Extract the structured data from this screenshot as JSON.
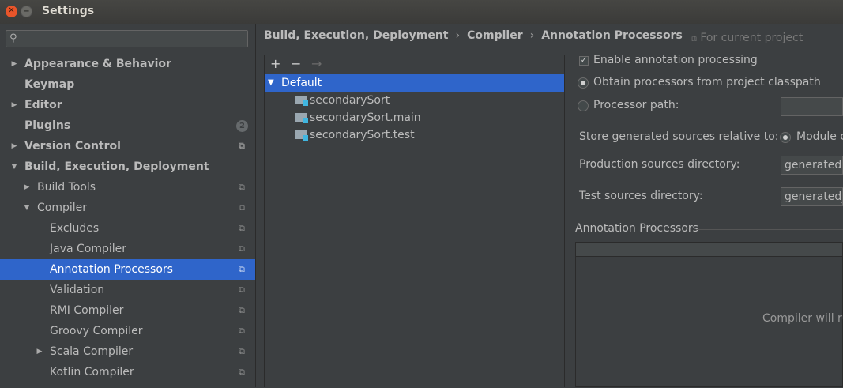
{
  "window": {
    "title": "Settings"
  },
  "search": {
    "placeholder": "",
    "value": ""
  },
  "tree": [
    {
      "label": "Appearance & Behavior",
      "arrow": "▶",
      "bold": true
    },
    {
      "label": "Keymap",
      "arrow": "",
      "bold": true
    },
    {
      "label": "Editor",
      "arrow": "▶",
      "bold": true
    },
    {
      "label": "Plugins",
      "arrow": "",
      "bold": true,
      "badge": "2"
    },
    {
      "label": "Version Control",
      "arrow": "▶",
      "bold": true,
      "project": true
    },
    {
      "label": "Build, Execution, Deployment",
      "arrow": "▼",
      "bold": true
    },
    {
      "label": "Build Tools",
      "arrow": "▶",
      "bold": false,
      "project": true
    },
    {
      "label": "Compiler",
      "arrow": "▼",
      "bold": false,
      "project": true
    },
    {
      "label": "Excludes",
      "arrow": "",
      "bold": false,
      "project": true
    },
    {
      "label": "Java Compiler",
      "arrow": "",
      "bold": false,
      "project": true
    },
    {
      "label": "Annotation Processors",
      "arrow": "",
      "bold": false,
      "project": true,
      "selected": true
    },
    {
      "label": "Validation",
      "arrow": "",
      "bold": false,
      "project": true
    },
    {
      "label": "RMI Compiler",
      "arrow": "",
      "bold": false,
      "project": true
    },
    {
      "label": "Groovy Compiler",
      "arrow": "",
      "bold": false,
      "project": true
    },
    {
      "label": "Scala Compiler",
      "arrow": "▶",
      "bold": false,
      "project": true
    },
    {
      "label": "Kotlin Compiler",
      "arrow": "",
      "bold": false,
      "project": true
    }
  ],
  "breadcrumb": {
    "part1": "Build, Execution, Deployment",
    "part2": "Compiler",
    "part3": "Annotation Processors",
    "sep": "›"
  },
  "scope_label": "For current project",
  "profile_toolbar": {
    "add": "+",
    "remove": "−",
    "move": "→"
  },
  "profiles": [
    {
      "label": "Default",
      "type": "group"
    },
    {
      "label": "secondarySort",
      "type": "module"
    },
    {
      "label": "secondarySort.main",
      "type": "module"
    },
    {
      "label": "secondarySort.test",
      "type": "module"
    }
  ],
  "options": {
    "enable_processing": "Enable annotation processing",
    "enable_checked": true,
    "obtain_from_classpath": "Obtain processors from project classpath",
    "processor_path": "Processor path:",
    "processor_path_value": "",
    "store_relative": "Store generated sources relative to:",
    "store_relative_option": "Module c",
    "production_dir_label": "Production sources directory:",
    "production_dir_value": "generated",
    "test_dir_label": "Test sources directory:",
    "test_dir_value": "generated_"
  },
  "annotation_processors": {
    "title": "Annotation Processors",
    "empty_text": "Compiler will ru"
  }
}
